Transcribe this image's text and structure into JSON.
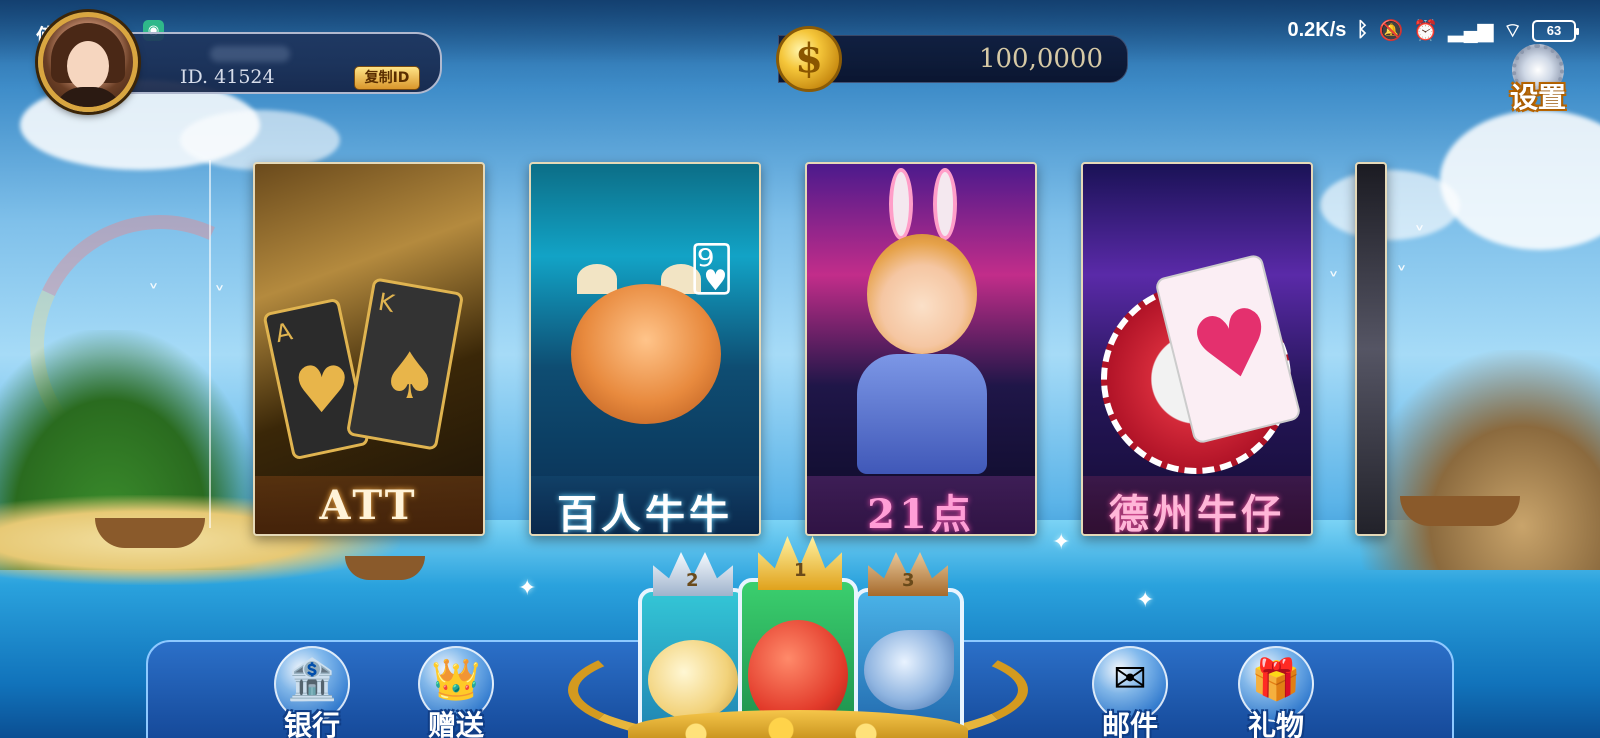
{
  "status_bar": {
    "time": "傍晚6:54",
    "app_indicator_icon": "wifi-hotspot-icon",
    "net_speed": "0.2K/s",
    "icons": [
      "bluetooth-icon",
      "mute-icon",
      "alarm-icon",
      "hd-signal-icon",
      "wifi-icon"
    ],
    "battery": "63"
  },
  "profile": {
    "id_text": "ID. 41524",
    "copy_id_label": "复制ID"
  },
  "currency": {
    "coin_symbol": "$",
    "amount": "100,0000"
  },
  "settings": {
    "label": "设置"
  },
  "games": [
    {
      "label": "ATT"
    },
    {
      "label": "百人牛牛"
    },
    {
      "label": "21点"
    },
    {
      "label": "德州牛仔"
    }
  ],
  "promo": {
    "ranks": [
      "2",
      "1",
      "3"
    ]
  },
  "bottom_nav": {
    "bank": "银行",
    "gift_send": "赠送",
    "mail": "邮件",
    "gift": "礼物"
  },
  "colors": {
    "gold_accent": "#d9a640",
    "nav_bar_blue": "#1d5fb8",
    "label_outline": "#0f3d86"
  }
}
